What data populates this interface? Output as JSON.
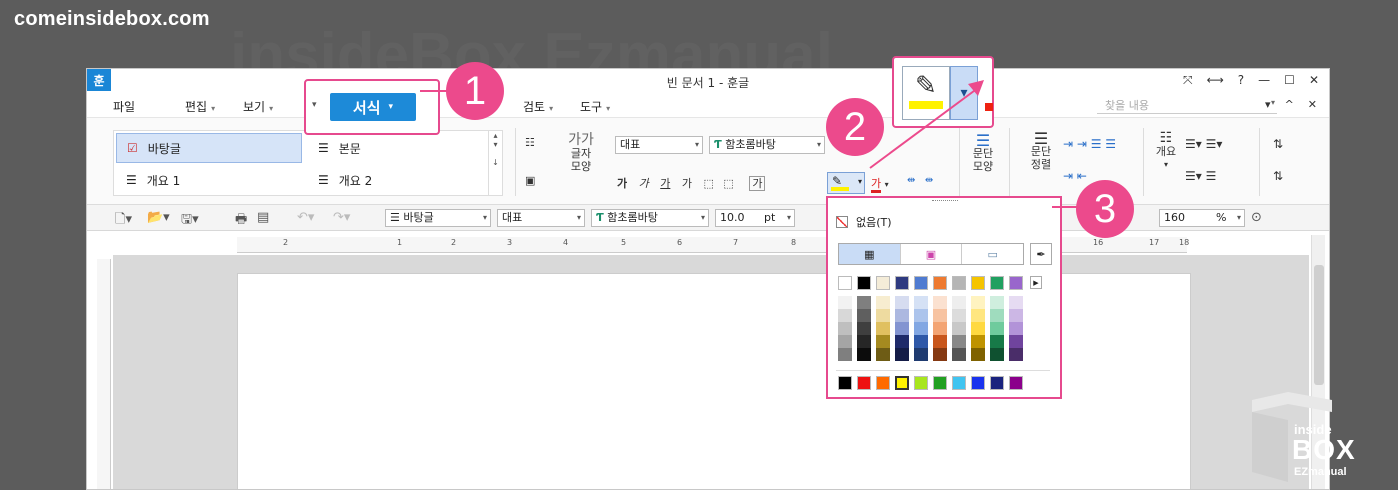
{
  "watermark": {
    "site": "comeinsidebox.com",
    "big": "insideBox Ezmanual"
  },
  "window": {
    "logo": "훈",
    "title": "빈 문서 1 - 훈글",
    "title_controls": [
      "⤧",
      "⟷",
      "?",
      "—",
      "☐",
      "✕"
    ]
  },
  "menu": {
    "items": [
      "파일",
      "편집",
      "보기",
      "서식",
      "검토",
      "도구"
    ],
    "find_placeholder": "찾을 내용",
    "controls": [
      "▾",
      "^",
      "✕"
    ]
  },
  "ribbon": {
    "styles": [
      {
        "label": "바탕글",
        "selected": true
      },
      {
        "label": "본문",
        "selected": false
      },
      {
        "label": "개요 1",
        "selected": false
      },
      {
        "label": "개요 2",
        "selected": false
      }
    ],
    "char_shape_label": "글자\n모양",
    "char_glyph": "가가",
    "style_field": "대표",
    "font_field": "함초롬바탕",
    "format_buttons": [
      "가",
      "가",
      "가",
      "가"
    ],
    "para_shape_label": "문단\n모양",
    "para_align_label": "문단\n정렬",
    "outline_label": "개요",
    "text_color_glyph": "가"
  },
  "toolbar2": {
    "style_field": "바탕글",
    "lang_field": "대표",
    "font_field": "함초롬바탕",
    "size_value": "10.0",
    "size_unit": "pt",
    "zoom_value": "160",
    "zoom_unit": "%"
  },
  "ruler": {
    "marks": [
      "2",
      "1",
      "2",
      "3",
      "4",
      "5",
      "6",
      "7",
      "8",
      "9",
      "16",
      "17",
      "18"
    ]
  },
  "palette": {
    "none_label": "없음(T)",
    "tabs": [
      "grid",
      "spectrum",
      "image"
    ]
  },
  "callouts": {
    "badge1": "1",
    "badge2": "2",
    "badge3": "3",
    "seosik": "서식"
  },
  "logo": {
    "line1": "inside",
    "line2": "BOX",
    "line3": "EZmanual"
  },
  "colors": {
    "accent_pink": "#ec4a8c",
    "brand_blue": "#1d8ad8",
    "highlight_yellow": "#fff200"
  }
}
